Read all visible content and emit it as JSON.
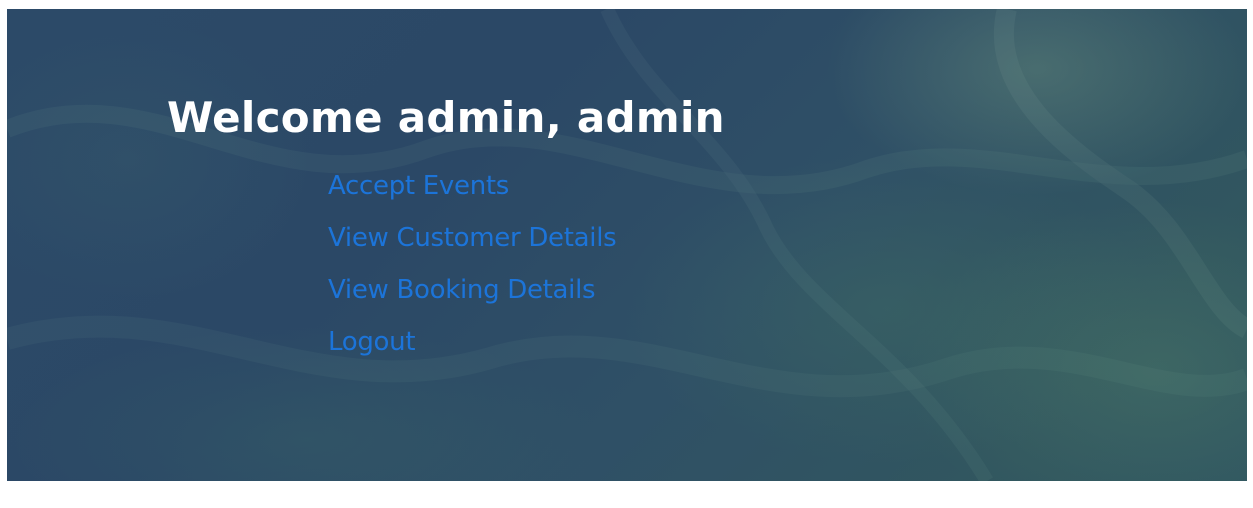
{
  "welcome": {
    "title": "Welcome admin, admin"
  },
  "menu": {
    "items": [
      {
        "label": "Accept Events"
      },
      {
        "label": "View Customer Details"
      },
      {
        "label": "View Booking Details"
      },
      {
        "label": "Logout"
      }
    ]
  },
  "colors": {
    "background": "#2c4a68",
    "title": "#ffffff",
    "link": "#1c74d9"
  }
}
